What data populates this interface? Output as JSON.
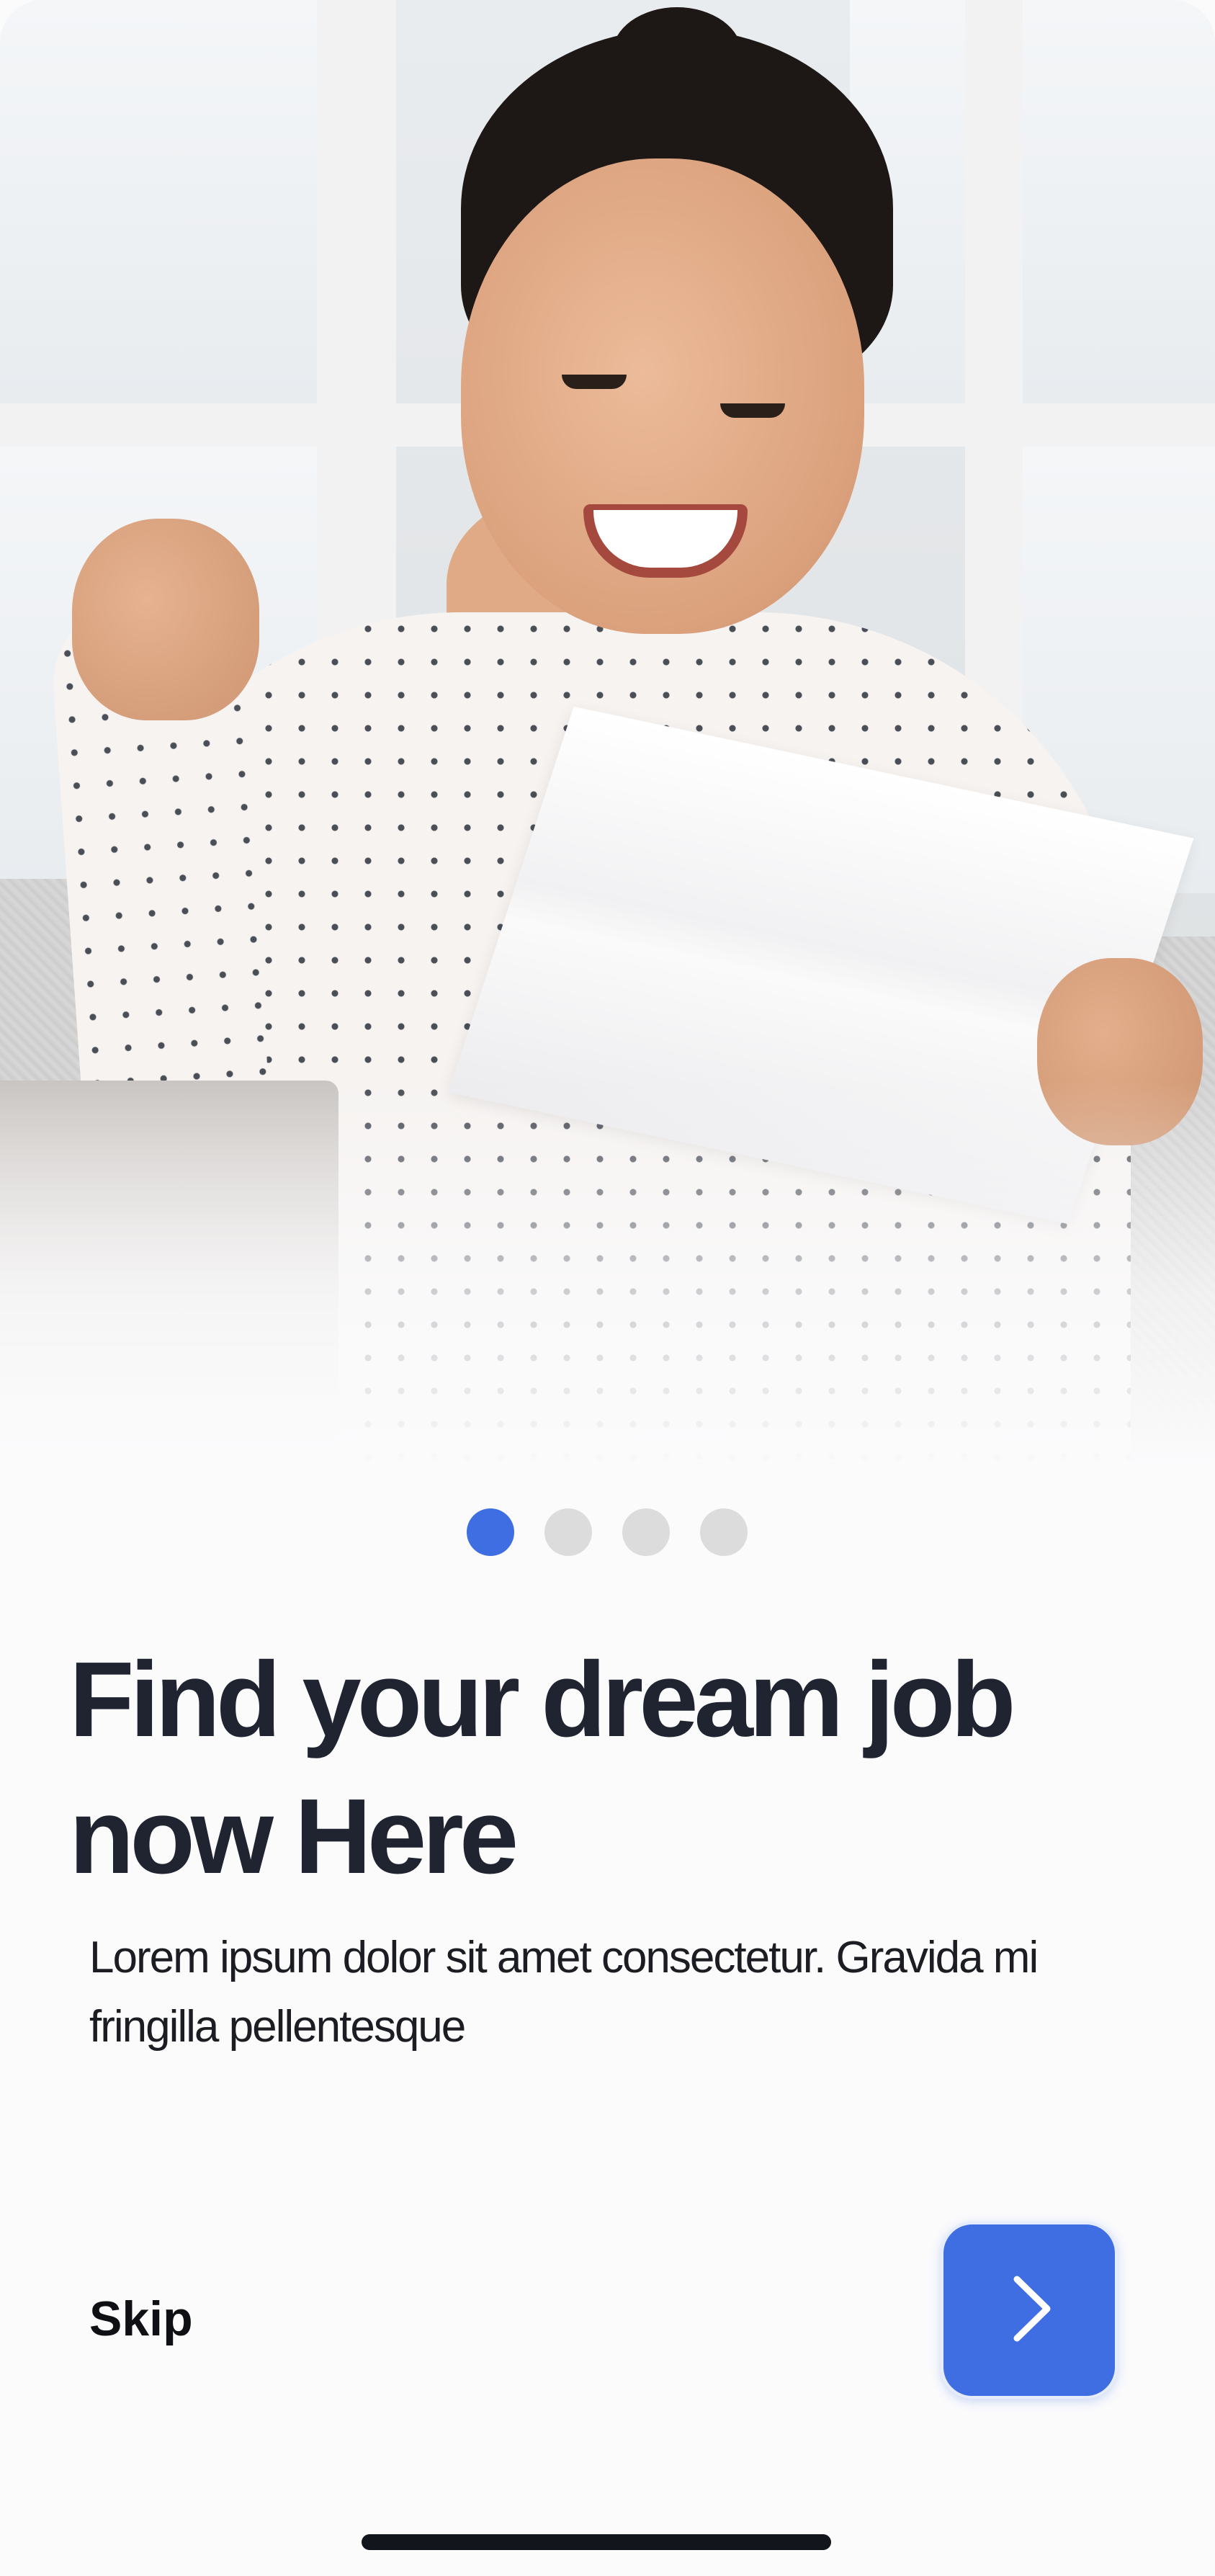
{
  "onboarding": {
    "pager": {
      "total": 4,
      "active_index": 0
    },
    "headline": "Find your dream job\nnow Here",
    "description": "Lorem ipsum dolor sit amet consectetur. Gravida mi fringilla pellentesque",
    "skip_label": "Skip",
    "next_icon": "chevron-right-icon"
  },
  "colors": {
    "accent": "#3f6ee3",
    "dot_inactive": "#dcdcdc",
    "headline": "#1f2430",
    "background": "#fbfbfc"
  }
}
